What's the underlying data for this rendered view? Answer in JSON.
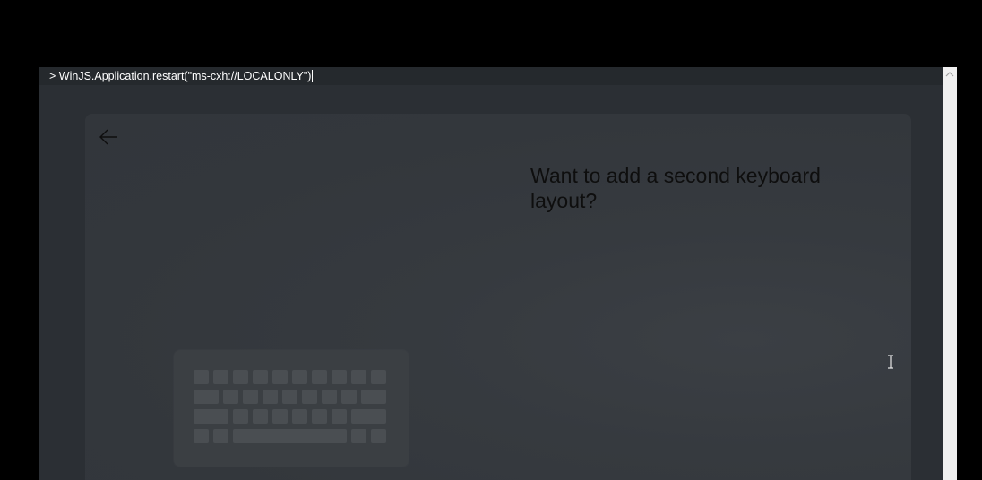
{
  "console": {
    "prompt": ">",
    "command": "WinJS.Application.restart(\"ms-cxh://LOCALONLY\")"
  },
  "dialog": {
    "title": "Want to add a second keyboard layout?"
  },
  "icons": {
    "back": "arrow-left-icon",
    "scroll_up": "chevron-up-icon",
    "keyboard": "keyboard-illustration",
    "cursor": "text-cursor-icon"
  },
  "colors": {
    "background": "#000000",
    "window": "#2b2f34",
    "dialog": "#363a3f",
    "title_text": "#0e0e0e",
    "console_text": "#ffffff"
  }
}
